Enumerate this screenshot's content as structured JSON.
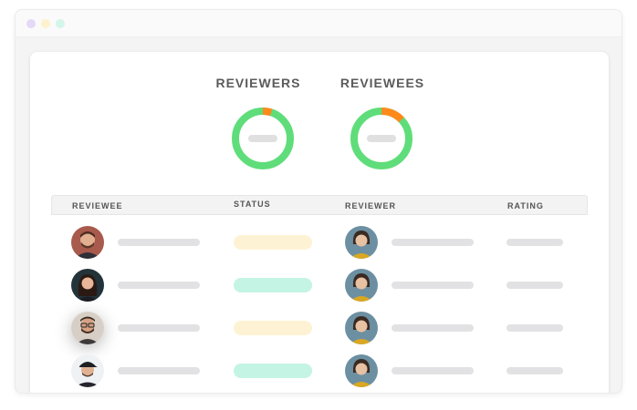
{
  "colors": {
    "dot1": "#e4d9f7",
    "dot2": "#fdf2cc",
    "dot3": "#d3f5ea",
    "donut_green": "#5fdd7a",
    "donut_orange": "#ff8a1c",
    "pending": "#fdf3d4",
    "complete": "#c4f4e3"
  },
  "stats": [
    {
      "title": "REVIEWERS",
      "completed_fraction": 0.95
    },
    {
      "title": "REVIEWEES",
      "completed_fraction": 0.87
    }
  ],
  "table": {
    "headers": [
      "REVIEWEE",
      "STATUS",
      "REVIEWER",
      "RATING"
    ],
    "rows": [
      {
        "reviewee_avatar": "man-beard-avatar",
        "status": "pending",
        "reviewer_avatar": "woman-reviewer-avatar"
      },
      {
        "reviewee_avatar": "woman-long-hair-avatar",
        "status": "complete",
        "reviewer_avatar": "woman-reviewer-avatar"
      },
      {
        "reviewee_avatar": "man-glasses-avatar",
        "status": "pending",
        "reviewer_avatar": "woman-reviewer-avatar"
      },
      {
        "reviewee_avatar": "man-cap-avatar",
        "status": "complete",
        "reviewer_avatar": "woman-reviewer-avatar"
      }
    ]
  }
}
